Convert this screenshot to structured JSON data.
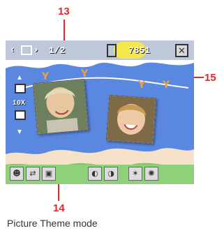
{
  "callouts": {
    "top": "13",
    "right": "15",
    "bottom": "14"
  },
  "topbar": {
    "page_indicator": "1/2",
    "counter": "7851",
    "prev_icon": "chevron-left-icon",
    "next_icon": "chevron-right-icon",
    "view_icon": "picture-frame-icon",
    "card_icon": "memory-card-icon",
    "close_icon": "close-x-icon"
  },
  "side_controls": {
    "zoom_label": "10X"
  },
  "bottom_toolbar": {
    "buttons": [
      {
        "icon": "portrait-icon"
      },
      {
        "icon": "switch-icon"
      },
      {
        "icon": "picture-theme-icon"
      },
      {
        "icon": "brightness-icon"
      },
      {
        "icon": "white-balance-icon"
      },
      {
        "icon": "effects-icon"
      },
      {
        "icon": "settings-icon"
      }
    ]
  },
  "caption": "Picture Theme mode",
  "colors": {
    "callout": "#e3262b",
    "sky": "#5a87e0",
    "highlight": "#f3e74a",
    "ground": "#8fd07a"
  }
}
